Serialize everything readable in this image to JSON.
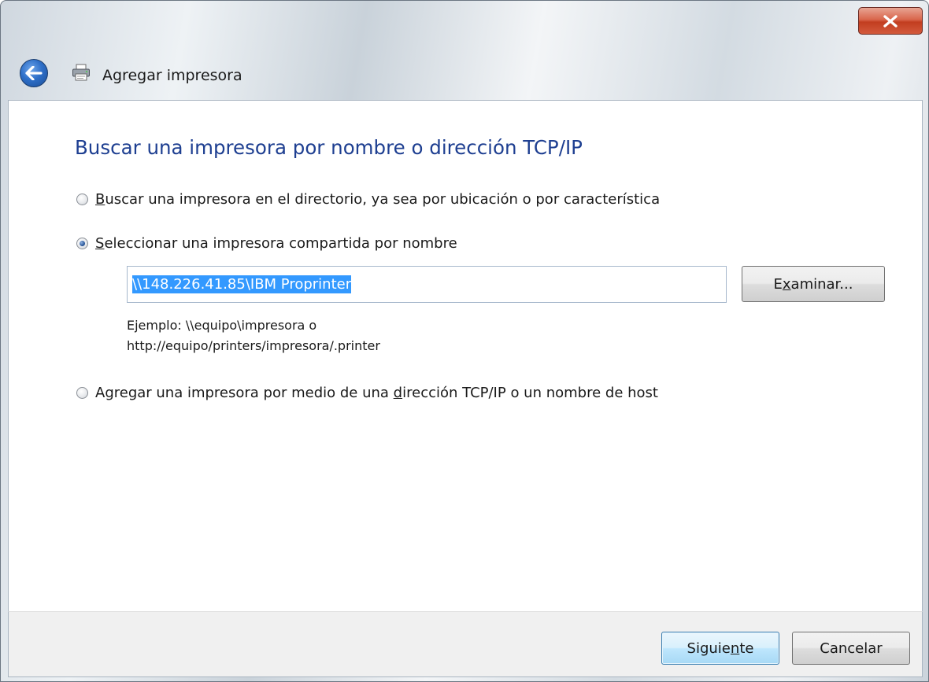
{
  "window": {
    "title": "Agregar impresora",
    "close_glyph": "x"
  },
  "icons": {
    "close": "close-icon",
    "back": "back-arrow-icon",
    "printer": "printer-icon"
  },
  "page": {
    "heading": "Buscar una impresora por nombre o dirección TCP/IP"
  },
  "options": [
    {
      "pre": "",
      "mnemonic": "B",
      "post": "uscar una impresora en el directorio, ya sea por ubicación o por característica",
      "selected": false
    },
    {
      "pre": "",
      "mnemonic": "S",
      "post": "eleccionar una impresora compartida por nombre",
      "selected": true
    },
    {
      "pre": "Agregar una impresora por medio de una ",
      "mnemonic": "d",
      "post": "irección TCP/IP o un nombre de host",
      "selected": false
    }
  ],
  "shared_printer": {
    "value": "\\\\148.226.41.85\\IBM Proprinter",
    "example_line1": "Ejemplo: \\\\equipo\\impresora o",
    "example_line2": "http://equipo/printers/impresora/.printer"
  },
  "buttons": {
    "browse": {
      "pre": "E",
      "mnemonic": "x",
      "post": "aminar..."
    },
    "next": {
      "pre": "Siguie",
      "mnemonic": "n",
      "post": "te"
    },
    "cancel": "Cancelar"
  },
  "colors": {
    "heading": "#1e3f91",
    "selection": "#3399ff",
    "close_red": "#c23d20"
  }
}
